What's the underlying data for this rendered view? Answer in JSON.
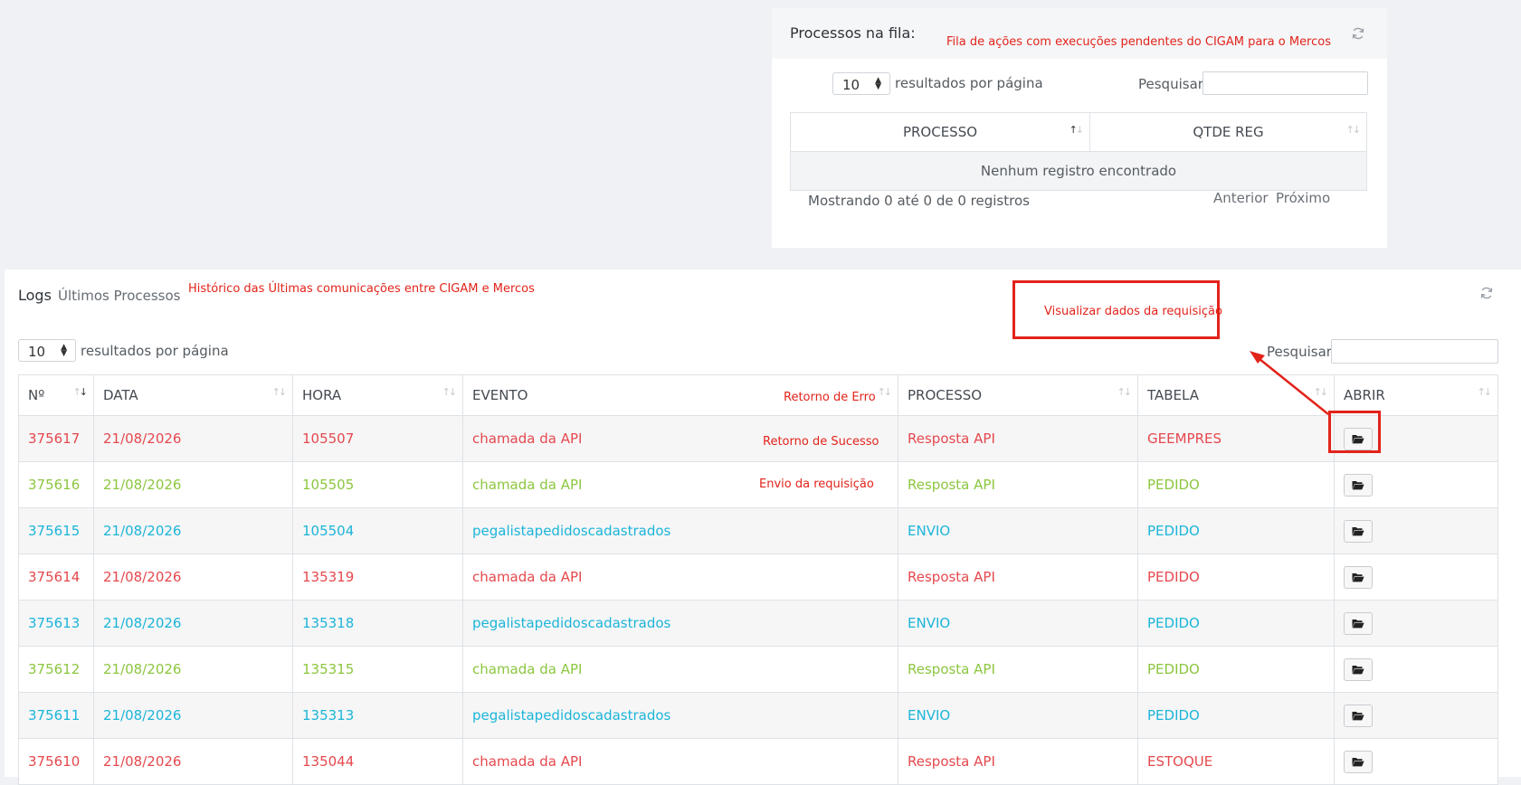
{
  "queue": {
    "title": "Processos na fila:",
    "annotation": "Fila de ações com execuções pendentes do CIGAM para o Mercos",
    "length_value": "10",
    "length_label": "resultados por página",
    "search_label": "Pesquisar",
    "search_value": "",
    "columns": [
      "PROCESSO",
      "QTDE REG"
    ],
    "empty_message": "Nenhum registro encontrado",
    "info": "Mostrando 0 até 0 de 0 registros",
    "prev_label": "Anterior",
    "next_label": "Próximo"
  },
  "logs": {
    "title": "Logs",
    "subtitle": "Últimos Processos",
    "annotation": "Histórico das Últimas comunicações entre CIGAM e Mercos",
    "callout": "Visualizar dados da requisição",
    "length_value": "10",
    "length_label": "resultados por página",
    "search_label": "Pesquisar",
    "search_value": "",
    "columns": [
      "Nº",
      "DATA",
      "HORA",
      "EVENTO",
      "PROCESSO",
      "TABELA",
      "ABRIR"
    ],
    "row_annotations": {
      "error": "Retorno de Erro",
      "success": "Retorno de Sucesso",
      "send": "Envio da requisição"
    },
    "rows": [
      {
        "num": "375617",
        "data": "21/08/2026",
        "hora": "105507",
        "evento": "chamada da API",
        "processo": "Resposta API",
        "tabela": "GEEMPRES"
      },
      {
        "num": "375616",
        "data": "21/08/2026",
        "hora": "105505",
        "evento": "chamada da API",
        "processo": "Resposta API",
        "tabela": "PEDIDO"
      },
      {
        "num": "375615",
        "data": "21/08/2026",
        "hora": "105504",
        "evento": "pegalistapedidoscadastrados",
        "processo": "ENVIO",
        "tabela": "PEDIDO"
      },
      {
        "num": "375614",
        "data": "21/08/2026",
        "hora": "135319",
        "evento": "chamada da API",
        "processo": "Resposta API",
        "tabela": "PEDIDO"
      },
      {
        "num": "375613",
        "data": "21/08/2026",
        "hora": "135318",
        "evento": "pegalistapedidoscadastrados",
        "processo": "ENVIO",
        "tabela": "PEDIDO"
      },
      {
        "num": "375612",
        "data": "21/08/2026",
        "hora": "135315",
        "evento": "chamada da API",
        "processo": "Resposta API",
        "tabela": "PEDIDO"
      },
      {
        "num": "375611",
        "data": "21/08/2026",
        "hora": "135313",
        "evento": "pegalistapedidoscadastrados",
        "processo": "ENVIO",
        "tabela": "PEDIDO"
      },
      {
        "num": "375610",
        "data": "21/08/2026",
        "hora": "135044",
        "evento": "chamada da API",
        "processo": "Resposta API",
        "tabela": "ESTOQUE"
      }
    ]
  },
  "colors": {
    "error": "#e5484d",
    "success": "#8cc63f",
    "send": "#1cb5d8",
    "annotation": "#e2231a"
  },
  "icons": {
    "refresh": "refresh-icon",
    "open": "folder-open-icon"
  }
}
